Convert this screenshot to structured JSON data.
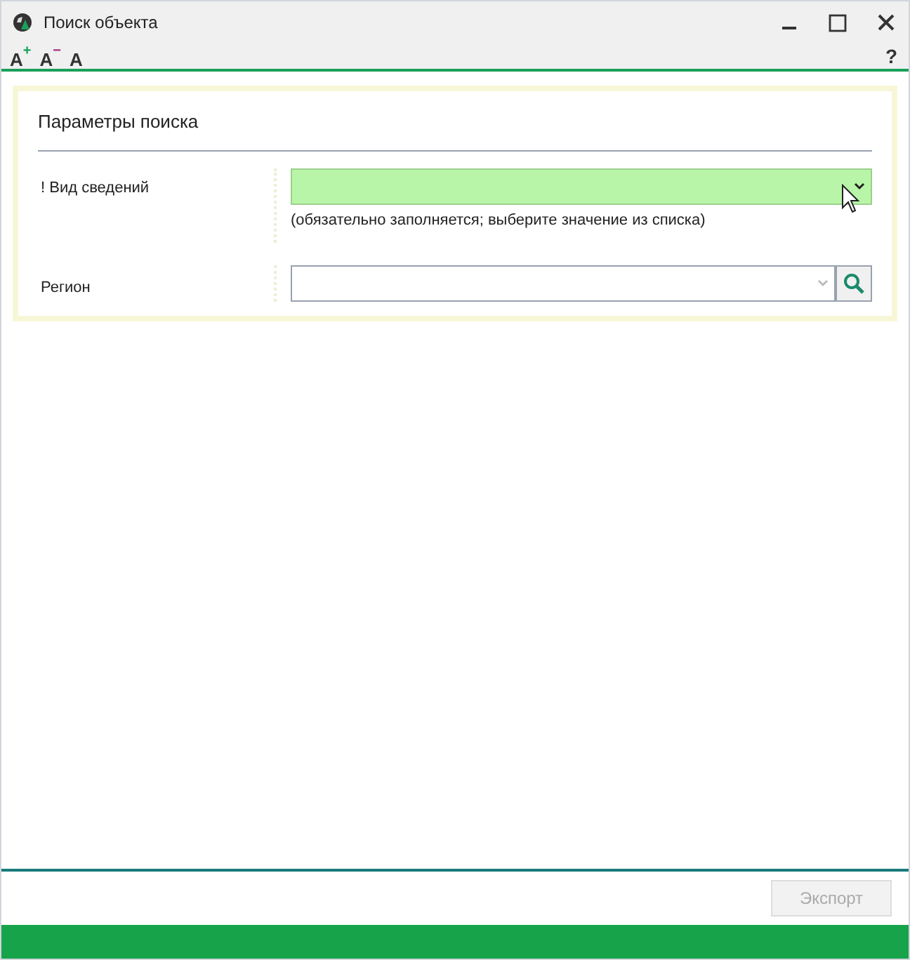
{
  "window": {
    "title": "Поиск объекта"
  },
  "toolbar": {
    "font_buttons": [
      {
        "letter": "A",
        "sign": "+",
        "kind": "increase"
      },
      {
        "letter": "A",
        "sign": "−",
        "kind": "decrease"
      },
      {
        "letter": "A",
        "kind": "reset"
      }
    ],
    "help": "?"
  },
  "panel": {
    "title": "Параметры поиска",
    "fields": [
      {
        "label": "! Вид сведений",
        "highlighted": true,
        "hint": "(обязательно заполняется; выберите значение из списка)",
        "search_button": false
      },
      {
        "label": "Регион",
        "highlighted": false,
        "search_button": true
      }
    ]
  },
  "footer": {
    "export_button": {
      "label": "Экспорт",
      "disabled": true
    }
  }
}
